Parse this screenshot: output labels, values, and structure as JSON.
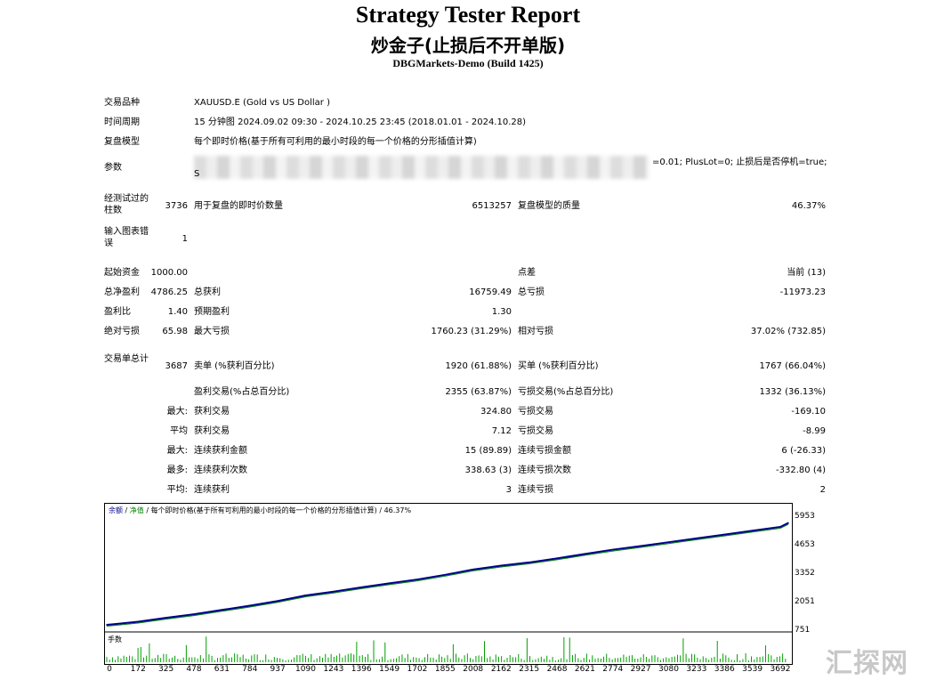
{
  "header": {
    "title": "Strategy Tester Report",
    "subtitle": "炒金子(止损后不开单版)",
    "server": "DBGMarkets-Demo (Build 1425)"
  },
  "settings": {
    "symbol_label": "交易品种",
    "symbol_value": "XAUUSD.E (Gold vs US Dollar )",
    "period_label": "时间周期",
    "period_value": "15 分钟图 2024.09.02 09:30 - 2024.10.25 23:45 (2018.01.01 - 2024.10.28)",
    "model_label": "复盘模型",
    "model_value": "每个即时价格(基于所有可利用的最小时段的每一个价格的分形插值计算)",
    "params_label": "参数",
    "params_visible_tail": "=0.01; PlusLot=0; 止损后是否停机=true;",
    "params_second_line_start": "S",
    "bars_label": "经测试过的柱数",
    "bars_value": "3736",
    "ticks_label": "用于复盘的即时价数量",
    "ticks_value": "6513257",
    "quality_label": "复盘模型的质量",
    "quality_value": "46.37%",
    "errors_label": "输入图表错误",
    "errors_value": "1"
  },
  "results": {
    "initial_deposit_label": "起始资金",
    "initial_deposit": "1000.00",
    "spread_label": "点差",
    "spread": "当前 (13)",
    "net_profit_label": "总净盈利",
    "net_profit": "4786.25",
    "gross_profit_label": "总获利",
    "gross_profit": "16759.49",
    "gross_loss_label": "总亏损",
    "gross_loss": "-11973.23",
    "profit_factor_label": "盈利比",
    "profit_factor": "1.40",
    "expected_payoff_label": "预期盈利",
    "expected_payoff": "1.30",
    "abs_dd_label": "绝对亏损",
    "abs_dd": "65.98",
    "max_dd_label": "最大亏损",
    "max_dd": "1760.23 (31.29%)",
    "rel_dd_label": "相对亏损",
    "rel_dd": "37.02% (732.85)",
    "total_trades_label": "交易单总计",
    "total_trades": "3687",
    "short_label": "卖单 (%获利百分比)",
    "short": "1920 (61.88%)",
    "long_label": "买单 (%获利百分比)",
    "long": "1767 (66.04%)",
    "profit_trades_label": "盈利交易(%占总百分比)",
    "profit_trades": "2355 (63.87%)",
    "loss_trades_label": "亏损交易(%占总百分比)",
    "loss_trades": "1332 (36.13%)",
    "largest_prefix": "最大:",
    "largest_profit_label": "获利交易",
    "largest_profit": "324.80",
    "largest_loss_label": "亏损交易",
    "largest_loss": "-169.10",
    "average_prefix": "平均",
    "avg_profit_label": "获利交易",
    "avg_profit": "7.12",
    "avg_loss_label": "亏损交易",
    "avg_loss": "-8.99",
    "max_prefix": "最大:",
    "max_consec_wins_label": "连续获利金额",
    "max_consec_wins": "15 (89.89)",
    "max_consec_losses_label": "连续亏损金额",
    "max_consec_losses": "6 (-26.33)",
    "maximal_prefix": "最多:",
    "maximal_consec_profit_label": "连续获利次数",
    "maximal_consec_profit": "338.63 (3)",
    "maximal_consec_loss_label": "连续亏损次数",
    "maximal_consec_loss": "-332.80 (4)",
    "avg_consec_prefix": "平均:",
    "avg_consec_wins_label": "连续获利",
    "avg_consec_wins": "3",
    "avg_consec_losses_label": "连续亏损",
    "avg_consec_losses": "2"
  },
  "chart_data": {
    "type": "line",
    "legend": {
      "balance": "余额",
      "sep1": " / ",
      "equity": "净值",
      "rest": " / 每个即时价格(基于所有可利用的最小时段的每一个价格的分形插值计算) / 46.37%"
    },
    "lots_label": "手数",
    "y_ticks": [
      "5953",
      "4653",
      "3352",
      "2051",
      "751"
    ],
    "x_ticks": [
      "0",
      "172",
      "325",
      "478",
      "631",
      "784",
      "937",
      "1090",
      "1243",
      "1396",
      "1549",
      "1702",
      "1855",
      "2008",
      "2162",
      "2315",
      "2468",
      "2621",
      "2774",
      "2927",
      "3080",
      "3233",
      "3386",
      "3539",
      "3692"
    ],
    "xlim": [
      0,
      3736
    ],
    "ylim": [
      751,
      6100
    ],
    "balance_series": [
      [
        0,
        1000
      ],
      [
        172,
        1150
      ],
      [
        325,
        1330
      ],
      [
        478,
        1500
      ],
      [
        631,
        1700
      ],
      [
        784,
        1900
      ],
      [
        937,
        2120
      ],
      [
        1090,
        2380
      ],
      [
        1243,
        2560
      ],
      [
        1396,
        2760
      ],
      [
        1549,
        2950
      ],
      [
        1702,
        3130
      ],
      [
        1855,
        3350
      ],
      [
        2008,
        3600
      ],
      [
        2162,
        3780
      ],
      [
        2315,
        3930
      ],
      [
        2468,
        4120
      ],
      [
        2621,
        4330
      ],
      [
        2774,
        4530
      ],
      [
        2927,
        4700
      ],
      [
        3080,
        4880
      ],
      [
        3233,
        5060
      ],
      [
        3386,
        5240
      ],
      [
        3539,
        5420
      ],
      [
        3692,
        5600
      ],
      [
        3736,
        5786
      ]
    ],
    "colors": {
      "balance": "#00008b",
      "equity": "#008000",
      "lots": "#00a000"
    }
  },
  "watermark": "汇探网"
}
